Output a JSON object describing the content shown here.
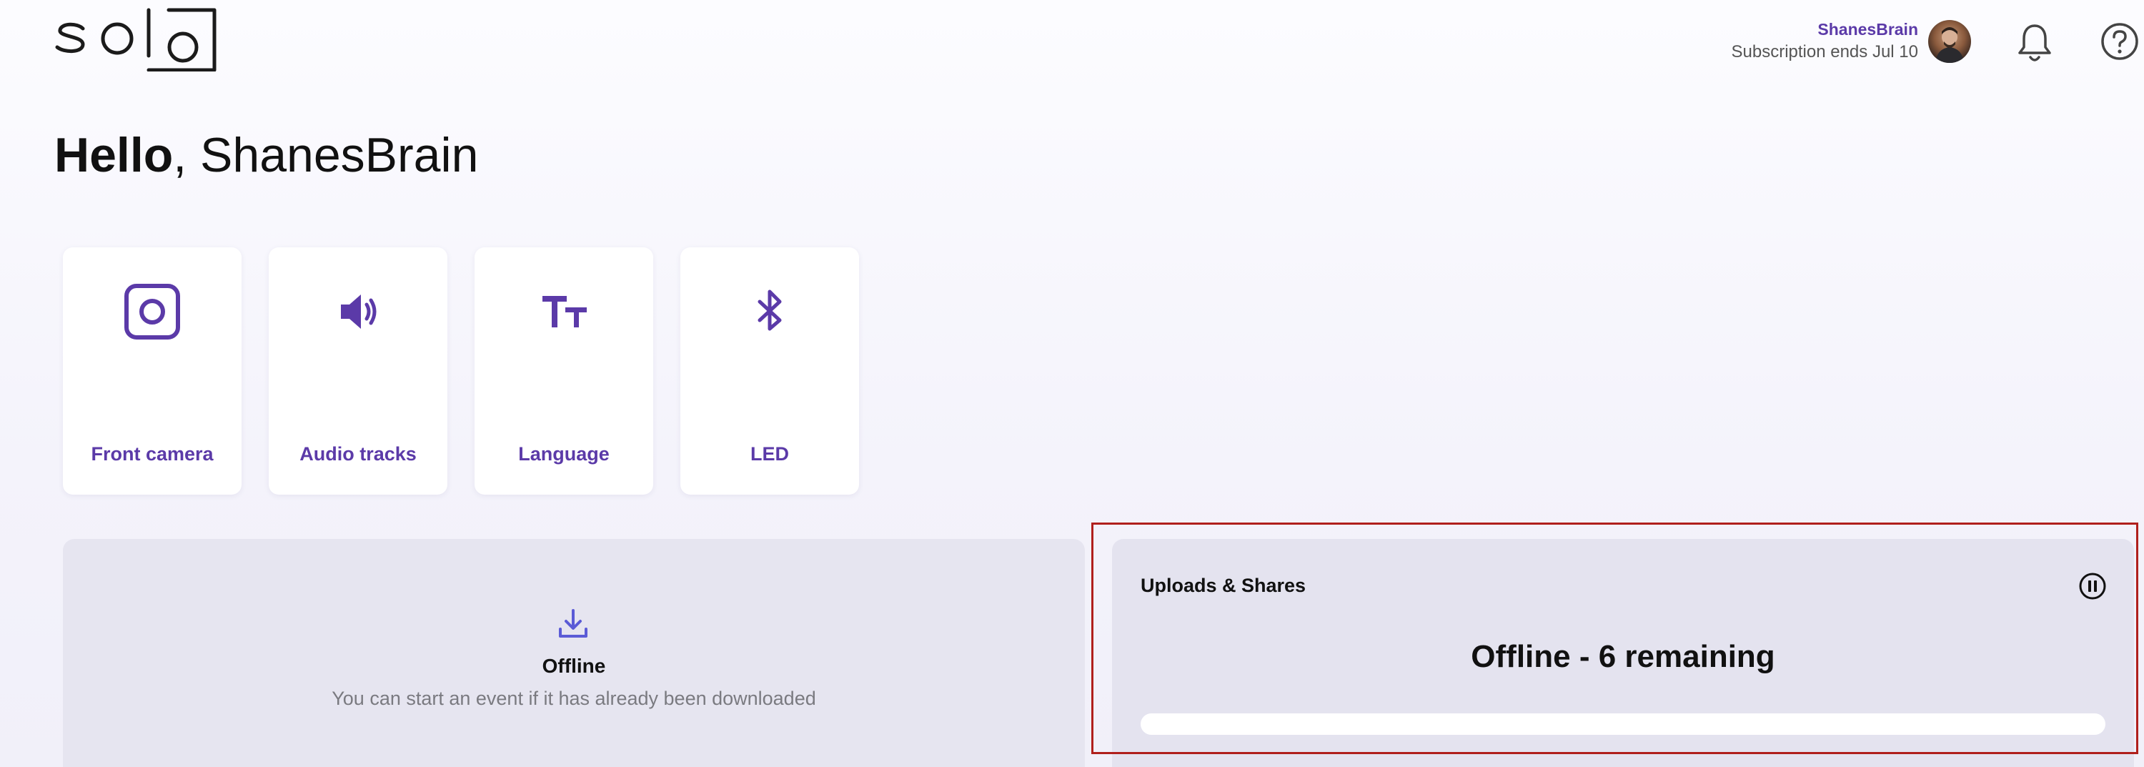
{
  "header": {
    "logo_text": "solo",
    "user_name": "ShanesBrain",
    "subscription": "Subscription ends Jul 10",
    "icons": {
      "avatar": "avatar",
      "notifications": "bell-icon",
      "help": "help-icon"
    }
  },
  "greeting": {
    "hello": "Hello",
    "comma": ",",
    "name": " ShanesBrain"
  },
  "tiles": [
    {
      "label": "Front camera",
      "icon": "camera-icon"
    },
    {
      "label": "Audio tracks",
      "icon": "speaker-icon"
    },
    {
      "label": "Language",
      "icon": "text-size-icon"
    },
    {
      "label": "LED",
      "icon": "bluetooth-icon"
    }
  ],
  "offline_panel": {
    "icon": "download-icon",
    "title": "Offline",
    "subtitle": "You can start an event if it has already been downloaded"
  },
  "uploads_panel": {
    "title": "Uploads & Shares",
    "status": "Offline - 6 remaining",
    "progress_percent": 0,
    "pause_icon": "pause-icon"
  },
  "colors": {
    "accent": "#5b3aa8",
    "highlight_border": "#b0201c",
    "panel_bg": "#e6e5f0"
  }
}
